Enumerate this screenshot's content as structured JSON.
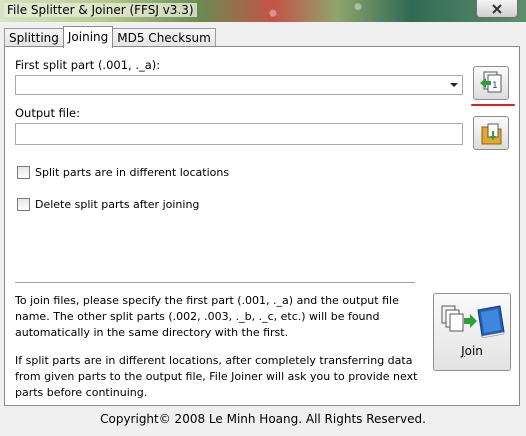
{
  "window": {
    "title": "File Splitter & Joiner (FFSJ v3.3)"
  },
  "tabs": [
    {
      "label": "Splitting"
    },
    {
      "label": "Joining"
    },
    {
      "label": "MD5 Checksum"
    }
  ],
  "joining": {
    "first_part_label": "First split part (.001, ._a):",
    "first_part_value": "",
    "output_label": "Output file:",
    "output_value": "",
    "option_different_locations": "Split parts are in different locations",
    "option_delete_after": "Delete split parts after joining",
    "info_paragraph_1": "To join files, please specify the first part (.001, ._a) and the output file name. The other split parts (.002, .003, ._b, ._c, etc.) will be found automatically in the same directory with the first.",
    "info_paragraph_2": "If split parts are in different locations, after completely transferring data from given parts to the output file, File Joiner will ask you to provide next parts before continuing.",
    "join_button_first": "J",
    "join_button_rest": "oin"
  },
  "footer": {
    "copyright": "Copyright© 2008 Le Minh Hoang. All Rights Reserved."
  },
  "colors": {
    "accent_red": "#e02020",
    "panel_bg": "#ffffff",
    "window_bg": "#f0f0f0"
  }
}
